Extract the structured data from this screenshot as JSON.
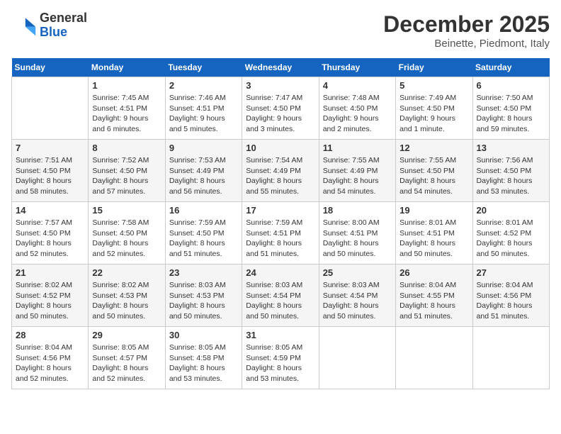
{
  "header": {
    "logo_general": "General",
    "logo_blue": "Blue",
    "month": "December 2025",
    "location": "Beinette, Piedmont, Italy"
  },
  "weekdays": [
    "Sunday",
    "Monday",
    "Tuesday",
    "Wednesday",
    "Thursday",
    "Friday",
    "Saturday"
  ],
  "weeks": [
    [
      {
        "day": "",
        "detail": ""
      },
      {
        "day": "1",
        "detail": "Sunrise: 7:45 AM\nSunset: 4:51 PM\nDaylight: 9 hours\nand 6 minutes."
      },
      {
        "day": "2",
        "detail": "Sunrise: 7:46 AM\nSunset: 4:51 PM\nDaylight: 9 hours\nand 5 minutes."
      },
      {
        "day": "3",
        "detail": "Sunrise: 7:47 AM\nSunset: 4:50 PM\nDaylight: 9 hours\nand 3 minutes."
      },
      {
        "day": "4",
        "detail": "Sunrise: 7:48 AM\nSunset: 4:50 PM\nDaylight: 9 hours\nand 2 minutes."
      },
      {
        "day": "5",
        "detail": "Sunrise: 7:49 AM\nSunset: 4:50 PM\nDaylight: 9 hours\nand 1 minute."
      },
      {
        "day": "6",
        "detail": "Sunrise: 7:50 AM\nSunset: 4:50 PM\nDaylight: 8 hours\nand 59 minutes."
      }
    ],
    [
      {
        "day": "7",
        "detail": "Sunrise: 7:51 AM\nSunset: 4:50 PM\nDaylight: 8 hours\nand 58 minutes."
      },
      {
        "day": "8",
        "detail": "Sunrise: 7:52 AM\nSunset: 4:50 PM\nDaylight: 8 hours\nand 57 minutes."
      },
      {
        "day": "9",
        "detail": "Sunrise: 7:53 AM\nSunset: 4:49 PM\nDaylight: 8 hours\nand 56 minutes."
      },
      {
        "day": "10",
        "detail": "Sunrise: 7:54 AM\nSunset: 4:49 PM\nDaylight: 8 hours\nand 55 minutes."
      },
      {
        "day": "11",
        "detail": "Sunrise: 7:55 AM\nSunset: 4:49 PM\nDaylight: 8 hours\nand 54 minutes."
      },
      {
        "day": "12",
        "detail": "Sunrise: 7:55 AM\nSunset: 4:50 PM\nDaylight: 8 hours\nand 54 minutes."
      },
      {
        "day": "13",
        "detail": "Sunrise: 7:56 AM\nSunset: 4:50 PM\nDaylight: 8 hours\nand 53 minutes."
      }
    ],
    [
      {
        "day": "14",
        "detail": "Sunrise: 7:57 AM\nSunset: 4:50 PM\nDaylight: 8 hours\nand 52 minutes."
      },
      {
        "day": "15",
        "detail": "Sunrise: 7:58 AM\nSunset: 4:50 PM\nDaylight: 8 hours\nand 52 minutes."
      },
      {
        "day": "16",
        "detail": "Sunrise: 7:59 AM\nSunset: 4:50 PM\nDaylight: 8 hours\nand 51 minutes."
      },
      {
        "day": "17",
        "detail": "Sunrise: 7:59 AM\nSunset: 4:51 PM\nDaylight: 8 hours\nand 51 minutes."
      },
      {
        "day": "18",
        "detail": "Sunrise: 8:00 AM\nSunset: 4:51 PM\nDaylight: 8 hours\nand 50 minutes."
      },
      {
        "day": "19",
        "detail": "Sunrise: 8:01 AM\nSunset: 4:51 PM\nDaylight: 8 hours\nand 50 minutes."
      },
      {
        "day": "20",
        "detail": "Sunrise: 8:01 AM\nSunset: 4:52 PM\nDaylight: 8 hours\nand 50 minutes."
      }
    ],
    [
      {
        "day": "21",
        "detail": "Sunrise: 8:02 AM\nSunset: 4:52 PM\nDaylight: 8 hours\nand 50 minutes."
      },
      {
        "day": "22",
        "detail": "Sunrise: 8:02 AM\nSunset: 4:53 PM\nDaylight: 8 hours\nand 50 minutes."
      },
      {
        "day": "23",
        "detail": "Sunrise: 8:03 AM\nSunset: 4:53 PM\nDaylight: 8 hours\nand 50 minutes."
      },
      {
        "day": "24",
        "detail": "Sunrise: 8:03 AM\nSunset: 4:54 PM\nDaylight: 8 hours\nand 50 minutes."
      },
      {
        "day": "25",
        "detail": "Sunrise: 8:03 AM\nSunset: 4:54 PM\nDaylight: 8 hours\nand 50 minutes."
      },
      {
        "day": "26",
        "detail": "Sunrise: 8:04 AM\nSunset: 4:55 PM\nDaylight: 8 hours\nand 51 minutes."
      },
      {
        "day": "27",
        "detail": "Sunrise: 8:04 AM\nSunset: 4:56 PM\nDaylight: 8 hours\nand 51 minutes."
      }
    ],
    [
      {
        "day": "28",
        "detail": "Sunrise: 8:04 AM\nSunset: 4:56 PM\nDaylight: 8 hours\nand 52 minutes."
      },
      {
        "day": "29",
        "detail": "Sunrise: 8:05 AM\nSunset: 4:57 PM\nDaylight: 8 hours\nand 52 minutes."
      },
      {
        "day": "30",
        "detail": "Sunrise: 8:05 AM\nSunset: 4:58 PM\nDaylight: 8 hours\nand 53 minutes."
      },
      {
        "day": "31",
        "detail": "Sunrise: 8:05 AM\nSunset: 4:59 PM\nDaylight: 8 hours\nand 53 minutes."
      },
      {
        "day": "",
        "detail": ""
      },
      {
        "day": "",
        "detail": ""
      },
      {
        "day": "",
        "detail": ""
      }
    ]
  ]
}
